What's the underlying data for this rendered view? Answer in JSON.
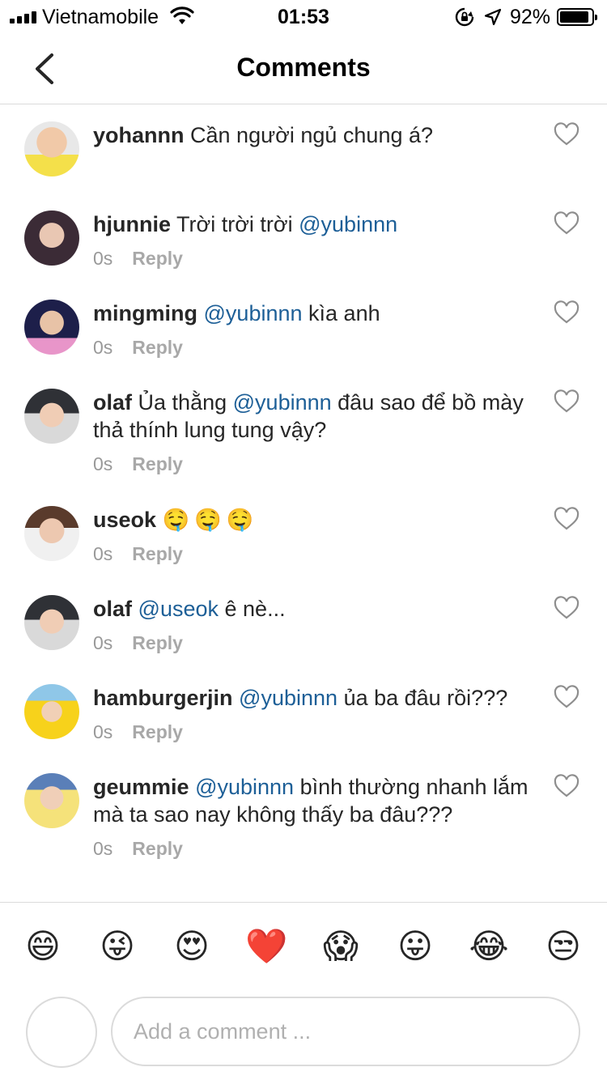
{
  "status_bar": {
    "carrier": "Vietnamobile",
    "time": "01:53",
    "battery": "92%",
    "battery_level": 0.92
  },
  "header": {
    "title": "Comments"
  },
  "comments": [
    {
      "username": "yohannn",
      "text": "Cần người ngủ chung á?",
      "mention": "",
      "rest": "",
      "time": "",
      "reply": ""
    },
    {
      "username": "hjunnie",
      "text": "Trời trời trời",
      "mention": "@yubinnn",
      "rest": "",
      "time": "0s",
      "reply": "Reply"
    },
    {
      "username": "mingming",
      "text": "",
      "mention": "@yubinnn",
      "rest": "kìa anh",
      "time": "0s",
      "reply": "Reply"
    },
    {
      "username": "olaf",
      "text": "Ủa thằng",
      "mention": "@yubinnn",
      "rest": "đâu sao để bồ mày thả thính lung tung vậy?",
      "time": "0s",
      "reply": "Reply"
    },
    {
      "username": "useok",
      "text": "🤤🤤🤤",
      "mention": "",
      "rest": "",
      "time": "0s",
      "reply": "Reply"
    },
    {
      "username": "olaf",
      "text": "",
      "mention": "@useok",
      "rest": "ê nè...",
      "time": "0s",
      "reply": "Reply"
    },
    {
      "username": "hamburgerjin",
      "text": "",
      "mention": "@yubinnn",
      "rest": "ủa ba đâu rồi???",
      "time": "0s",
      "reply": "Reply"
    },
    {
      "username": "geummie",
      "text": "",
      "mention": "@yubinnn",
      "rest": "bình thường nhanh lắm mà ta sao nay không thấy ba đâu???",
      "time": "0s",
      "reply": "Reply"
    }
  ],
  "emoji_bar": [
    "😄",
    "😜",
    "😍",
    "❤️",
    "😱",
    "😛",
    "😂",
    "😒"
  ],
  "composer": {
    "placeholder": "Add a comment ..."
  },
  "colors": {
    "mention": "#1d5f97",
    "meta": "#999999",
    "divider": "#dbdbdb"
  }
}
